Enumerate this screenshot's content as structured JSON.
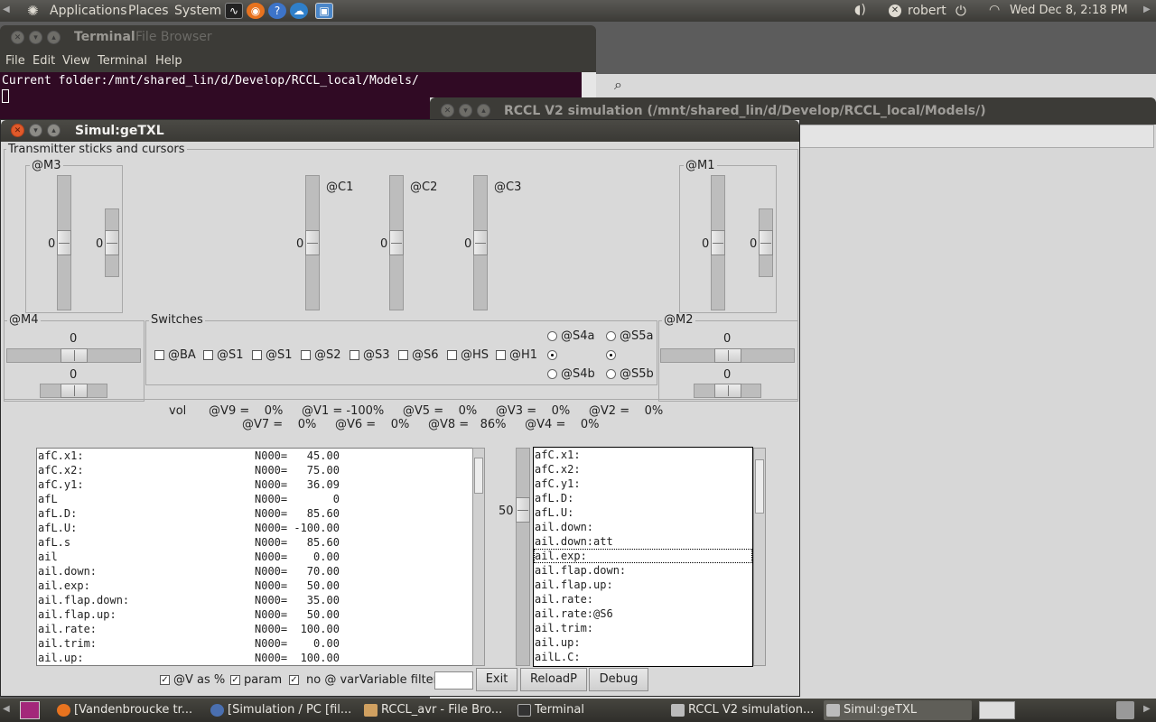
{
  "topbar": {
    "applications": "Applications",
    "places": "Places",
    "system": "System",
    "user": "robert",
    "datetime": "Wed Dec  8,  2:18 PM"
  },
  "terminal": {
    "title": "Terminal",
    "title_behind": "File Browser",
    "menu": [
      "File",
      "Edit",
      "View",
      "Terminal",
      "Help"
    ],
    "line": "Current folder:/mnt/shared_lin/d/Develop/RCCL_local/Models/"
  },
  "rccl_window": {
    "title": "RCCL V2 simulation (/mnt/shared_lin/d/Develop/RCCL_local/Models/)"
  },
  "simul": {
    "title": "Simul:geTXL",
    "group_title": "Transmitter sticks and cursors",
    "m3": {
      "label": "@M3",
      "v1": "0",
      "v2": "0"
    },
    "c1": {
      "label": "@C1",
      "v": "0"
    },
    "c2": {
      "label": "@C2",
      "v": "0"
    },
    "c3": {
      "label": "@C3",
      "v": "0"
    },
    "m1": {
      "label": "@M1",
      "v1": "0",
      "v2": "0"
    },
    "m4": {
      "label": "@M4",
      "v1": "0",
      "v2": "0"
    },
    "m2": {
      "label": "@M2",
      "v1": "0",
      "v2": "0"
    },
    "switches": {
      "title": "Switches",
      "checks": [
        "@BA",
        "@S1",
        "@S1",
        "@S2",
        "@S3",
        "@S6",
        "@HS",
        "@H1"
      ],
      "radios": {
        "s4a": "@S4a",
        "s4b": "@S4b",
        "s5a": "@S5a",
        "s5b": "@S5b"
      }
    },
    "vol": {
      "line1": "vol      @V9 =    0%     @V1 = -100%     @V5 =    0%     @V3 =    0%     @V2 =    0%",
      "line2": "@V7 =    0%     @V6 =    0%     @V8 =   86%     @V4 =    0%"
    },
    "left_list": [
      [
        "afC.x1:",
        "N000=   45.00"
      ],
      [
        "afC.x2:",
        "N000=   75.00"
      ],
      [
        "afC.y1:",
        "N000=   36.09"
      ],
      [
        "afL",
        "N000=       0"
      ],
      [
        "afL.D:",
        "N000=   85.60"
      ],
      [
        "afL.U:",
        "N000= -100.00"
      ],
      [
        "afL.s",
        "N000=   85.60"
      ],
      [
        "ail",
        "N000=    0.00"
      ],
      [
        "ail.down:",
        "N000=   70.00"
      ],
      [
        "ail.exp:",
        "N000=   50.00"
      ],
      [
        "ail.flap.down:",
        "N000=   35.00"
      ],
      [
        "ail.flap.up:",
        "N000=   50.00"
      ],
      [
        "ail.rate:",
        "N000=  100.00"
      ],
      [
        "ail.trim:",
        "N000=    0.00"
      ],
      [
        "ail.up:",
        "N000=  100.00"
      ]
    ],
    "mid_slider": "50",
    "right_list": [
      "afC.x1:",
      "afC.x2:",
      "afC.y1:",
      "afL.D:",
      "afL.U:",
      "ail.down:",
      "ail.down:att",
      "ail.exp:",
      "ail.flap.down:",
      "ail.flap.up:",
      "ail.rate:",
      "ail.rate:@S6",
      "ail.trim:",
      "ail.up:",
      "ailL.C:"
    ],
    "bottom": {
      "v_as_pct": "@V as %",
      "param": "param",
      "no_var": "no @ var",
      "filter_label": "Variable filter",
      "filter_value": "",
      "exit": "Exit",
      "reload": "ReloadP",
      "debug": "Debug"
    }
  },
  "taskbar": [
    "[Vandenbroucke tr...",
    "[Simulation / PC [fil...",
    "RCCL_avr - File Bro...",
    "Terminal",
    "RCCL V2 simulation...",
    "Simul:geTXL"
  ]
}
